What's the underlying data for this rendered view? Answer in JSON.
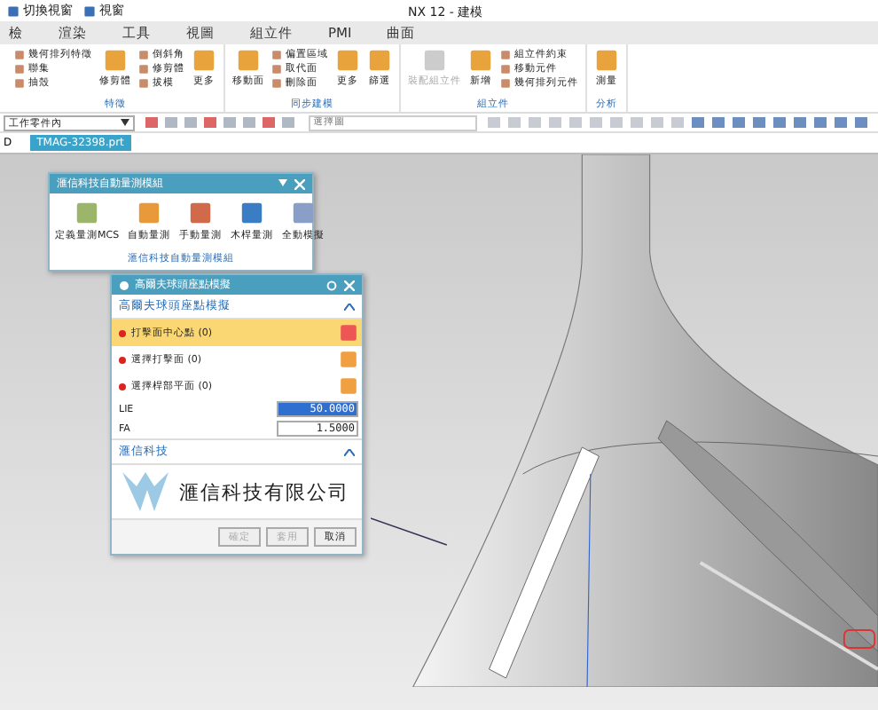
{
  "title_bar": {
    "quick_items": [
      "切換視窗",
      "視窗"
    ],
    "title": "NX 12 - 建模"
  },
  "menu_tabs": [
    {
      "label": "檢",
      "selected": false
    },
    {
      "label": "渲染",
      "selected": false
    },
    {
      "label": "工具",
      "selected": false
    },
    {
      "label": "視圖",
      "selected": false
    },
    {
      "label": "組立件",
      "selected": false
    },
    {
      "label": "PMI",
      "selected": false
    },
    {
      "label": "曲面",
      "selected": false
    }
  ],
  "ribbon_groups": [
    {
      "label": "特徵",
      "items": [
        {
          "kind": "small",
          "labels": [
            "幾何排列特徵",
            "聯集",
            "抽殼"
          ]
        },
        {
          "kind": "big",
          "label": "修剪體",
          "disabled": false
        },
        {
          "kind": "small",
          "labels": [
            "倒斜角",
            "修剪體",
            "拔模"
          ]
        },
        {
          "kind": "big",
          "label": "更多",
          "disabled": false
        }
      ]
    },
    {
      "label": "同步建模",
      "items": [
        {
          "kind": "big",
          "label": "移動面",
          "disabled": false
        },
        {
          "kind": "small",
          "labels": [
            "偏置區域",
            "取代面",
            "刪除面"
          ]
        },
        {
          "kind": "big",
          "label": "更多",
          "disabled": false
        },
        {
          "kind": "big",
          "label": "篩選",
          "disabled": false
        }
      ]
    },
    {
      "label": "組立件",
      "items": [
        {
          "kind": "big",
          "label": "裝配組立件",
          "disabled": true
        },
        {
          "kind": "big",
          "label": "新增",
          "disabled": false
        },
        {
          "kind": "small",
          "labels": [
            "組立件約束",
            "移動元件",
            "幾何排列元件"
          ]
        }
      ]
    },
    {
      "label": "分析",
      "items": [
        {
          "kind": "big",
          "label": "測量",
          "disabled": false
        }
      ]
    }
  ],
  "selection_bar": {
    "filter": "工作零件內",
    "placeholder": "選擇圖"
  },
  "file_tabs": {
    "prefix": "D",
    "file": "TMAG-32398.prt"
  },
  "measure_panel": {
    "title": "滙信科技自動量測模組",
    "tools": [
      "定義量測MCS",
      "自動量測",
      "手動量測",
      "木桿量測",
      "全動模擬"
    ],
    "footer": "滙信科技自動量測模組"
  },
  "sim_dialog": {
    "title": "高爾夫球頭座點模擬",
    "section": "高爾夫球頭座點模擬",
    "selections": [
      {
        "label": "打擊面中心點 (0)",
        "selected": true
      },
      {
        "label": "選擇打擊面 (0)",
        "selected": false
      },
      {
        "label": "選擇桿部平面 (0)",
        "selected": false
      }
    ],
    "fields": [
      {
        "label": "LIE",
        "value": "50.0000",
        "selected": true
      },
      {
        "label": "FA",
        "value": "1.5000",
        "selected": false
      }
    ],
    "company_section": "滙信科技",
    "company_name": "滙信科技有限公司",
    "buttons": [
      {
        "label": "確定",
        "disabled": true
      },
      {
        "label": "套用",
        "disabled": true
      },
      {
        "label": "取消",
        "disabled": false
      }
    ]
  }
}
